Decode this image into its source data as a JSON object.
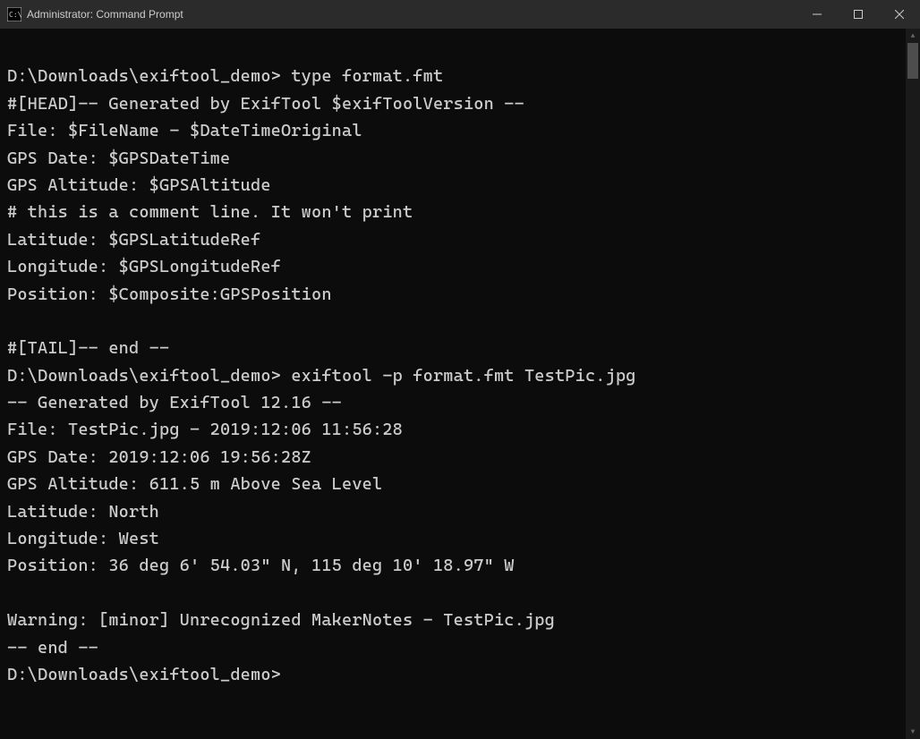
{
  "window": {
    "title": "Administrator: Command Prompt"
  },
  "terminal": {
    "lines": [
      {
        "prompt": "D:\\Downloads\\exiftool_demo>",
        "command": " type format.fmt"
      },
      {
        "text": "#[HEAD]-- Generated by ExifTool $exifToolVersion --"
      },
      {
        "text": "File: $FileName - $DateTimeOriginal"
      },
      {
        "text": "GPS Date: $GPSDateTime"
      },
      {
        "text": "GPS Altitude: $GPSAltitude"
      },
      {
        "text": "# this is a comment line. It won't print"
      },
      {
        "text": "Latitude: $GPSLatitudeRef"
      },
      {
        "text": "Longitude: $GPSLongitudeRef"
      },
      {
        "text": "Position: $Composite:GPSPosition"
      },
      {
        "text": ""
      },
      {
        "text": "#[TAIL]-- end --"
      },
      {
        "prompt": "D:\\Downloads\\exiftool_demo>",
        "command": " exiftool -p format.fmt TestPic.jpg"
      },
      {
        "text": "-- Generated by ExifTool 12.16 --"
      },
      {
        "text": "File: TestPic.jpg - 2019:12:06 11:56:28"
      },
      {
        "text": "GPS Date: 2019:12:06 19:56:28Z"
      },
      {
        "text": "GPS Altitude: 611.5 m Above Sea Level"
      },
      {
        "text": "Latitude: North"
      },
      {
        "text": "Longitude: West"
      },
      {
        "text": "Position: 36 deg 6' 54.03\" N, 115 deg 10' 18.97\" W"
      },
      {
        "text": ""
      },
      {
        "text": "Warning: [minor] Unrecognized MakerNotes - TestPic.jpg"
      },
      {
        "text": "-- end --"
      },
      {
        "prompt": "D:\\Downloads\\exiftool_demo>",
        "command": ""
      }
    ]
  }
}
